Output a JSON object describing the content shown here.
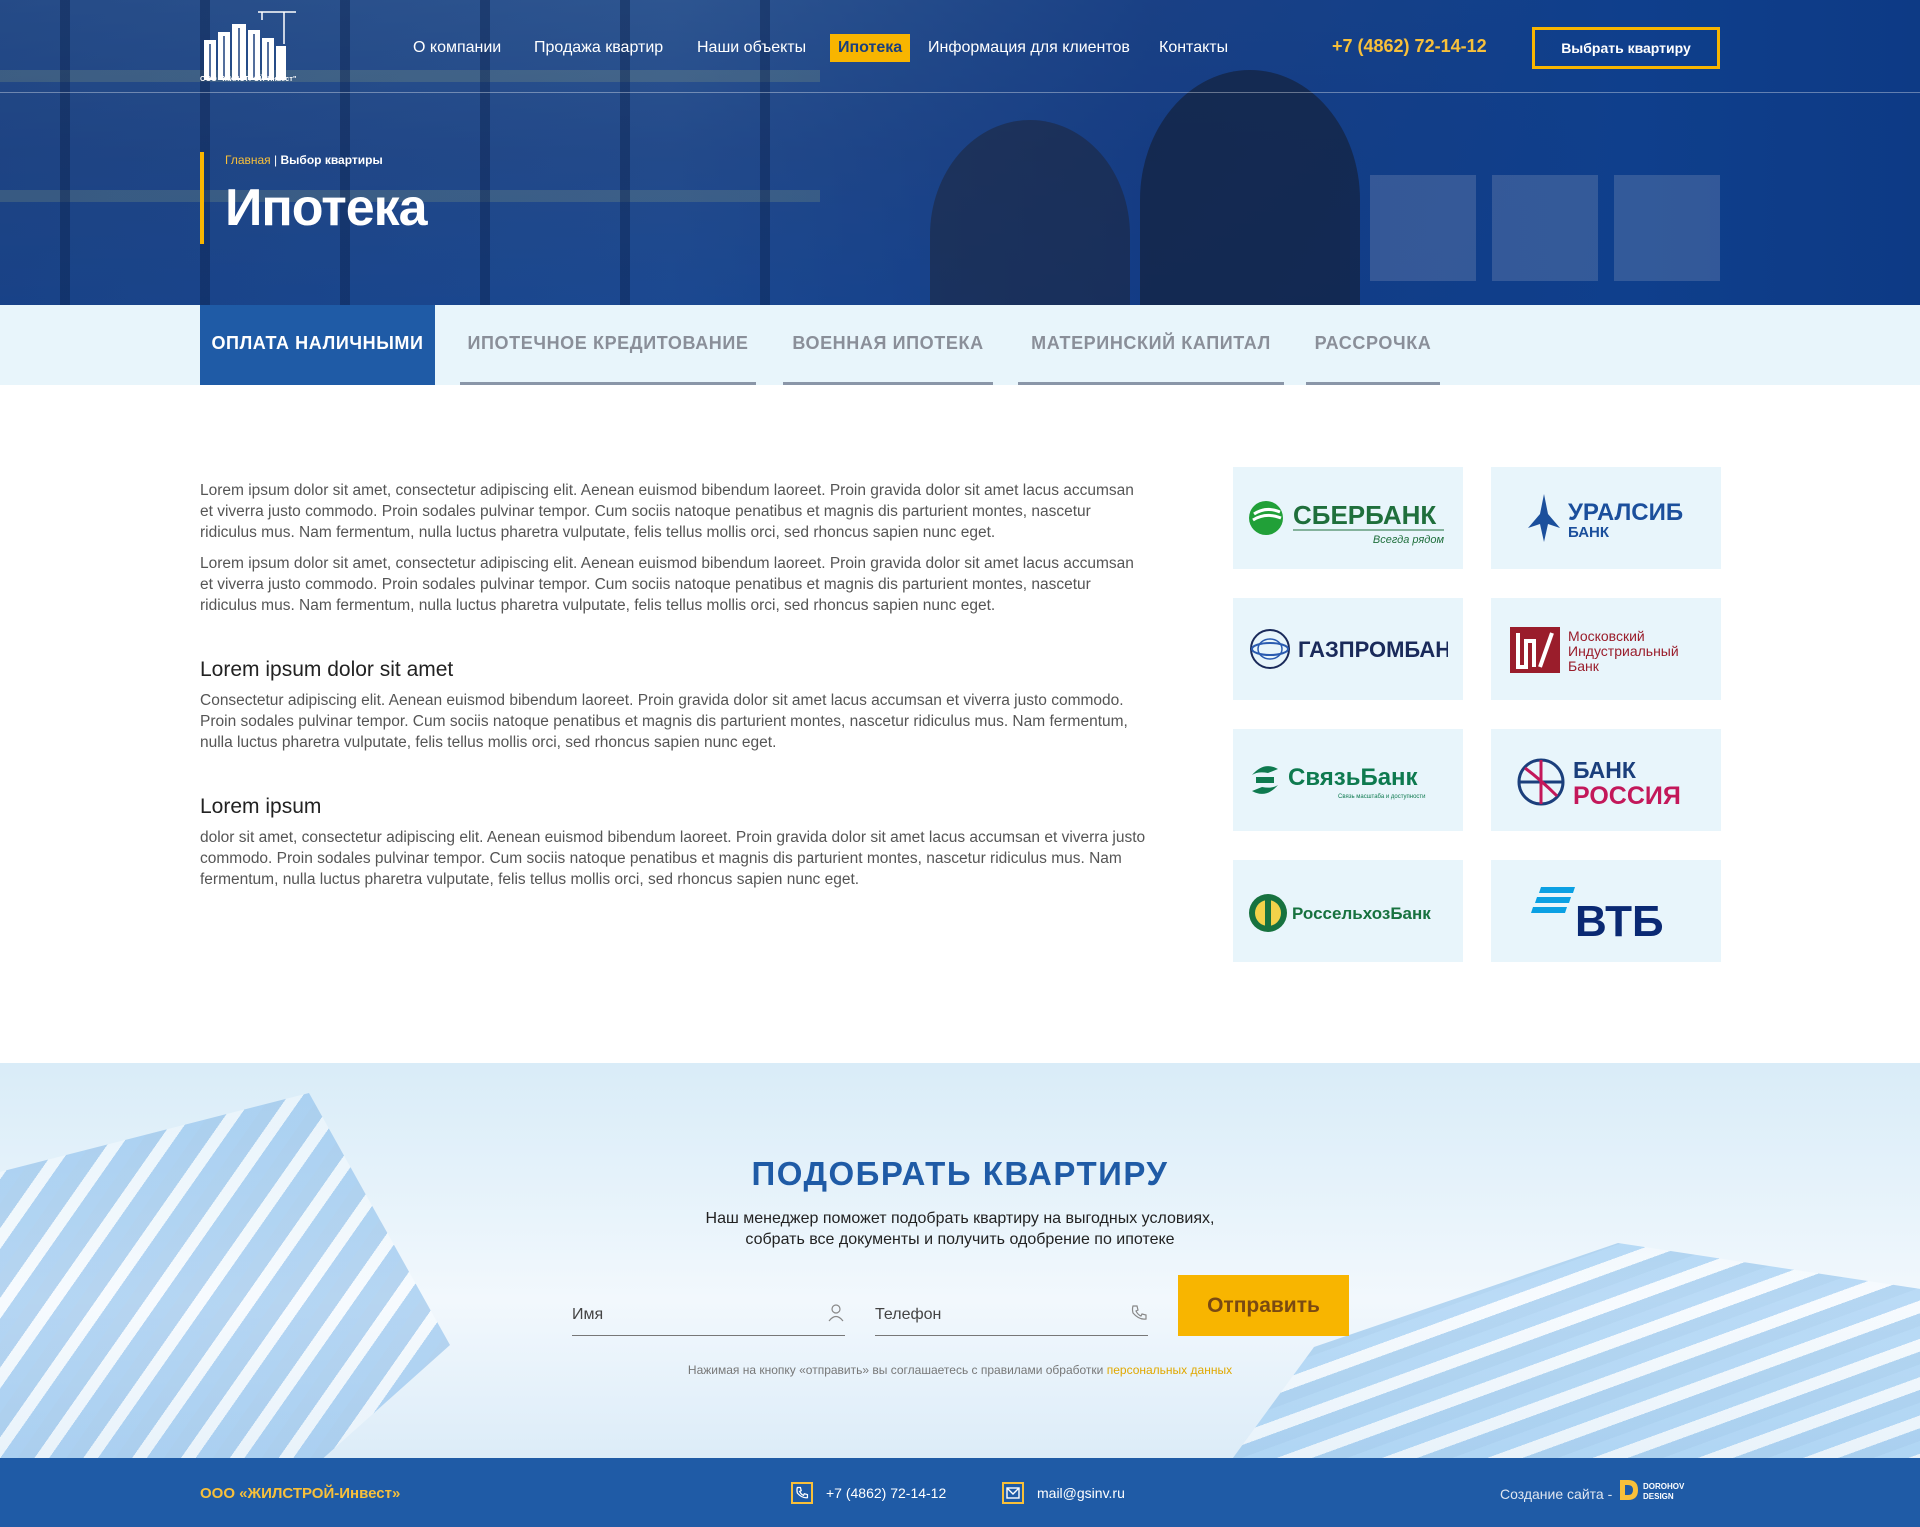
{
  "header": {
    "logo_caption": "ООО \"ЖИЛСТРОЙ-Инвест\"",
    "nav": [
      "О компании",
      "Продажа квартир",
      "Наши объекты",
      "Ипотека",
      "Информация для клиентов",
      "Контакты"
    ],
    "nav_active": "Ипотека",
    "phone": "+7 (4862) 72-14-12",
    "cta_button": "Выбрать квартиру"
  },
  "breadcrumb": {
    "home": "Главная",
    "separator": "|",
    "current": "Выбор квартиры"
  },
  "page_title": "Ипотека",
  "tabs": [
    "ОПЛАТА НАЛИЧНЫМИ",
    "ИПОТЕЧНОЕ КРЕДИТОВАНИЕ",
    "ВОЕННАЯ ИПОТЕКА",
    "МАТЕРИНСКИЙ КАПИТАЛ",
    "РАССРОЧКА"
  ],
  "active_tab": "ОПЛАТА НАЛИЧНЫМИ",
  "content": {
    "p1": "Lorem ipsum dolor sit amet, consectetur adipiscing elit. Aenean euismod bibendum laoreet. Proin gravida dolor sit amet lacus accumsan et viverra justo commodo. Proin sodales pulvinar tempor. Cum sociis natoque penatibus et magnis dis parturient montes, nascetur ridiculus mus. Nam fermentum, nulla luctus pharetra vulputate, felis tellus mollis orci, sed rhoncus sapien nunc eget.",
    "p2": "Lorem ipsum dolor sit amet, consectetur adipiscing elit. Aenean euismod bibendum laoreet. Proin gravida dolor sit amet lacus accumsan et viverra justo commodo. Proin sodales pulvinar tempor. Cum sociis natoque penatibus et magnis dis parturient montes, nascetur ridiculus mus. Nam fermentum, nulla luctus pharetra vulputate, felis tellus mollis orci, sed rhoncus sapien nunc eget.",
    "h1": "Lorem ipsum dolor sit amet",
    "p3": "Consectetur adipiscing elit. Aenean euismod bibendum laoreet. Proin gravida dolor sit amet lacus accumsan et viverra justo commodo. Proin sodales pulvinar tempor. Cum sociis natoque penatibus et magnis dis parturient montes, nascetur ridiculus mus. Nam fermentum, nulla luctus pharetra vulputate, felis tellus mollis orci, sed rhoncus sapien nunc eget.",
    "h2": "Lorem ipsum",
    "p4": "dolor sit amet, consectetur adipiscing elit. Aenean euismod bibendum laoreet. Proin gravida dolor sit amet lacus accumsan et viverra justo commodo. Proin sodales pulvinar tempor. Cum sociis natoque penatibus et magnis dis parturient montes, nascetur ridiculus mus. Nam fermentum, nulla luctus pharetra vulputate, felis tellus mollis orci, sed rhoncus sapien nunc eget."
  },
  "banks": {
    "sber": {
      "name": "СБЕРБАНК",
      "slogan": "Всегда рядом",
      "color": "#21a038"
    },
    "uralsib": {
      "name": "УРАЛСИБ",
      "sub": "БАНК",
      "color": "#1b4f9c"
    },
    "gazprom": {
      "name": "ГАЗПРОМБАНК",
      "color": "#1a2a5a"
    },
    "mib": {
      "line1": "Московский",
      "line2": "Индустриальный",
      "line3": "Банк",
      "color": "#9a1d2b"
    },
    "svyaz": {
      "name": "СвязьБанк",
      "slogan": "Связь масштаба и доступности",
      "color": "#0e7a4f"
    },
    "russia": {
      "line1": "БАНК",
      "line2": "РОССИЯ",
      "color1": "#1b3f7c",
      "color2": "#c3185a"
    },
    "rshb": {
      "name": "РоссельхозБанк",
      "color": "#17723f"
    },
    "vtb": {
      "name": "ВТБ",
      "color": "#0a2973",
      "accent": "#0aa0e3"
    }
  },
  "cta": {
    "title": "ПОДОБРАТЬ КВАРТИРУ",
    "line1": "Наш менеджер поможет подобрать квартиру на выгодных условиях,",
    "line2": "собрать все документы и получить одобрение по ипотеке",
    "name_placeholder": "Имя",
    "phone_placeholder": "Телефон",
    "submit": "Отправить",
    "consent_text": "Нажимая на кнопку «отправить» вы соглашаетесь с правилами обработки",
    "consent_link": "персональных данных"
  },
  "footer": {
    "company": "ООО «ЖИЛСТРОЙ-Инвест»",
    "phone": "+7 (4862) 72-14-12",
    "email": "mail@gsinv.ru",
    "credit": "Создание сайта -",
    "studio_line1": "DOROHOV",
    "studio_line2": "DESIGN"
  },
  "colors": {
    "brand_blue": "#1f5ba6",
    "accent_yellow": "#f8b500",
    "light_bg": "#e8f5fb"
  }
}
